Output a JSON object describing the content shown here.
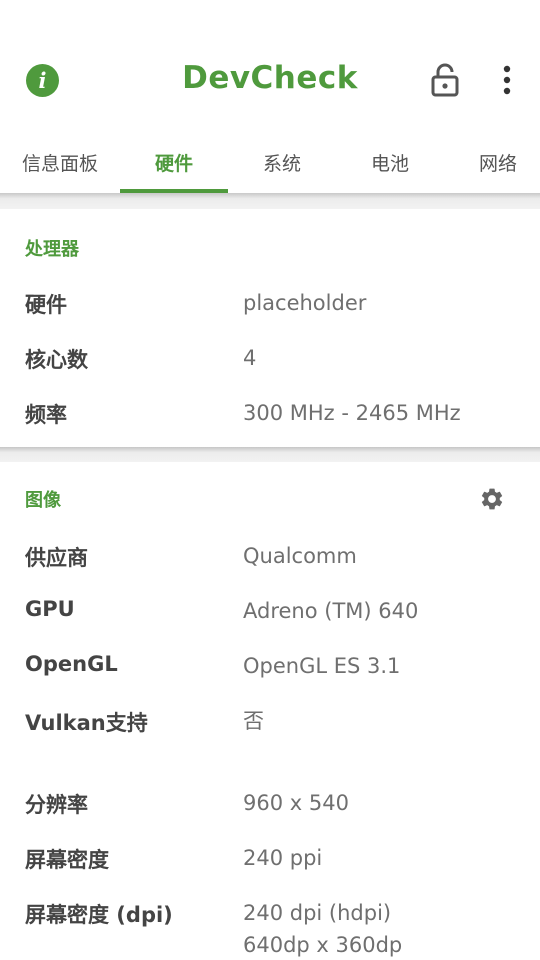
{
  "app": {
    "title": "DevCheck"
  },
  "icons": {
    "info": "info-icon",
    "lock": "lock-icon",
    "more": "more-vert-icon",
    "settings": "gear-icon"
  },
  "colors": {
    "accent": "#4f9a3d"
  },
  "tabs": [
    {
      "label": "信息面板",
      "active": false
    },
    {
      "label": "硬件",
      "active": true
    },
    {
      "label": "系统",
      "active": false
    },
    {
      "label": "电池",
      "active": false
    },
    {
      "label": "网络",
      "active": false
    }
  ],
  "processor": {
    "title": "处理器",
    "rows": [
      {
        "label": "硬件",
        "value": " placeholder"
      },
      {
        "label": "核心数",
        "value": "4"
      },
      {
        "label": "频率",
        "value": "300 MHz - 2465 MHz"
      }
    ]
  },
  "graphics": {
    "title": "图像",
    "rows": [
      {
        "label": "供应商",
        "value": "Qualcomm"
      },
      {
        "label": "GPU",
        "value": "Adreno (TM) 640"
      },
      {
        "label": "OpenGL",
        "value": "OpenGL ES 3.1"
      },
      {
        "label": "Vulkan支持",
        "value": "否"
      },
      {
        "label": "分辨率",
        "value": "960 x 540"
      },
      {
        "label": "屏幕密度",
        "value": "240 ppi"
      },
      {
        "label": "屏幕密度 (dpi)",
        "value": "240 dpi (hdpi)",
        "value2": "640dp x 360dp"
      }
    ]
  }
}
